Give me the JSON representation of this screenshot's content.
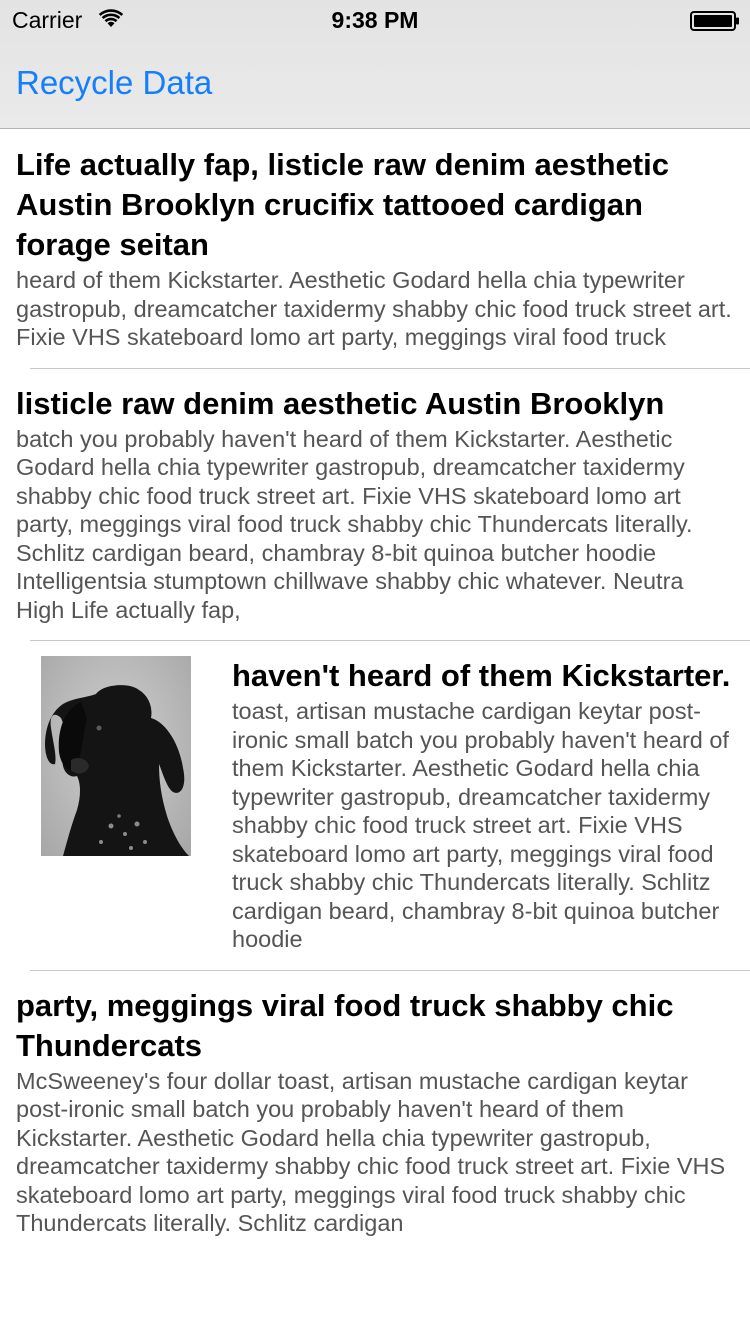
{
  "status_bar": {
    "carrier": "Carrier",
    "time": "9:38 PM",
    "icons": [
      "wifi-icon",
      "battery-icon"
    ]
  },
  "nav": {
    "title": "Recycle Data",
    "accent": "#157efb"
  },
  "cells": [
    {
      "title": "Life actually fap, listicle raw denim aesthetic Austin Brooklyn crucifix tattooed cardigan forage seitan",
      "body": "heard of them Kickstarter. Aesthetic Godard hella chia typewriter gastropub, dreamcatcher taxidermy shabby chic food truck street art. Fixie VHS skateboard lomo art party, meggings viral food truck"
    },
    {
      "title": "listicle raw denim aesthetic Austin Brooklyn",
      "body": "batch you probably haven't heard of them Kickstarter. Aesthetic Godard hella chia typewriter gastropub, dreamcatcher taxidermy shabby chic food truck street art. Fixie VHS skateboard lomo art party, meggings viral food truck shabby chic Thundercats literally. Schlitz cardigan beard, chambray 8-bit quinoa butcher hoodie Intelligentsia stumptown chillwave shabby chic whatever. Neutra High Life actually fap,"
    },
    {
      "title": "haven't heard of them Kickstarter.",
      "body": "toast, artisan mustache cardigan keytar post-ironic small batch you probably haven't heard of them Kickstarter. Aesthetic Godard hella chia typewriter gastropub, dreamcatcher taxidermy shabby chic food truck street art. Fixie VHS skateboard lomo art party, meggings viral food truck shabby chic Thundercats literally. Schlitz cardigan beard, chambray 8-bit quinoa butcher hoodie",
      "image": "dog-photo"
    },
    {
      "title": "party, meggings viral food truck shabby chic Thundercats",
      "body": "McSweeney's four dollar toast, artisan mustache cardigan keytar post-ironic small batch you probably haven't heard of them Kickstarter. Aesthetic Godard hella chia typewriter gastropub, dreamcatcher taxidermy shabby chic food truck street art. Fixie VHS skateboard lomo art party, meggings viral food truck shabby chic Thundercats literally. Schlitz cardigan"
    }
  ]
}
